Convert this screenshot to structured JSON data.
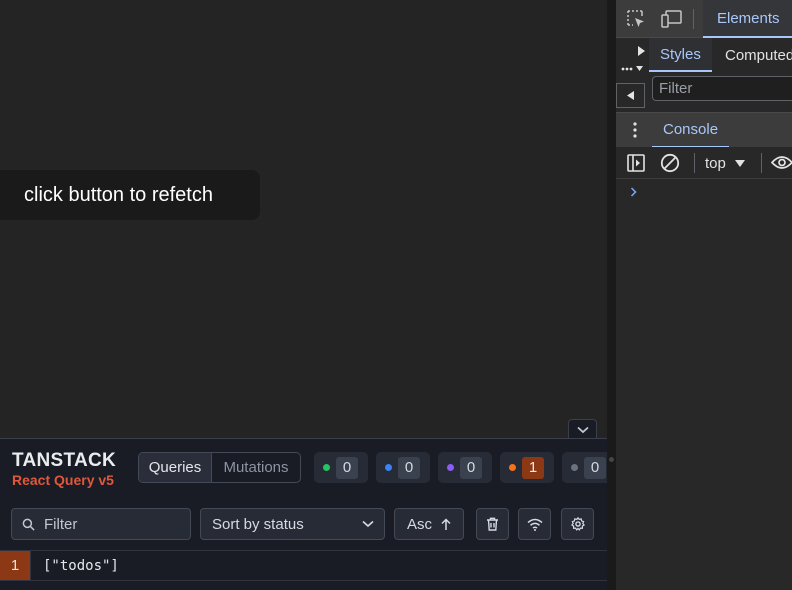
{
  "app": {
    "refetch_button_label": "click button to refetch"
  },
  "react_query_devtools": {
    "brand_line1": "TANSTACK",
    "brand_line2": "React Query v5",
    "tabs": [
      {
        "label": "Queries",
        "active": true
      },
      {
        "label": "Mutations",
        "active": false
      }
    ],
    "status_counts": [
      {
        "status": "fresh",
        "color": "#22c55e",
        "count": "0"
      },
      {
        "status": "fetching",
        "color": "#3b82f6",
        "count": "0"
      },
      {
        "status": "paused",
        "color": "#8b5cf6",
        "count": "0"
      },
      {
        "status": "stale",
        "color": "#f97316",
        "count": "1"
      },
      {
        "status": "inactive",
        "color": "#6b7280",
        "count": "0"
      }
    ],
    "filter_placeholder": "Filter",
    "sort_label": "Sort by status",
    "order_label": "Asc",
    "queries": [
      {
        "observers": "1",
        "key": "[\"todos\"]"
      }
    ]
  },
  "chrome_devtools": {
    "main_tab": "Elements",
    "sub_tabs": [
      "Styles",
      "Computed"
    ],
    "styles_filter_placeholder": "Filter",
    "drawer_tab": "Console",
    "console_context": "top"
  }
}
